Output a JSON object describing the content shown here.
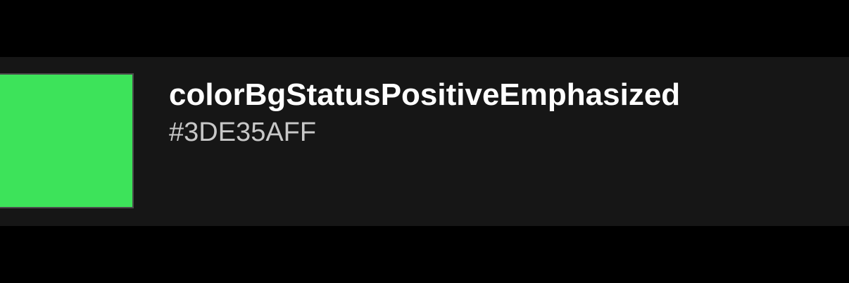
{
  "token": {
    "name": "colorBgStatusPositiveEmphasized",
    "value": "#3DE35AFF",
    "swatch_color": "#3DE35A"
  },
  "colors": {
    "background": "#000000",
    "row_background": "#161616",
    "name_text": "#FFFFFF",
    "value_text": "#C8C8C8"
  }
}
